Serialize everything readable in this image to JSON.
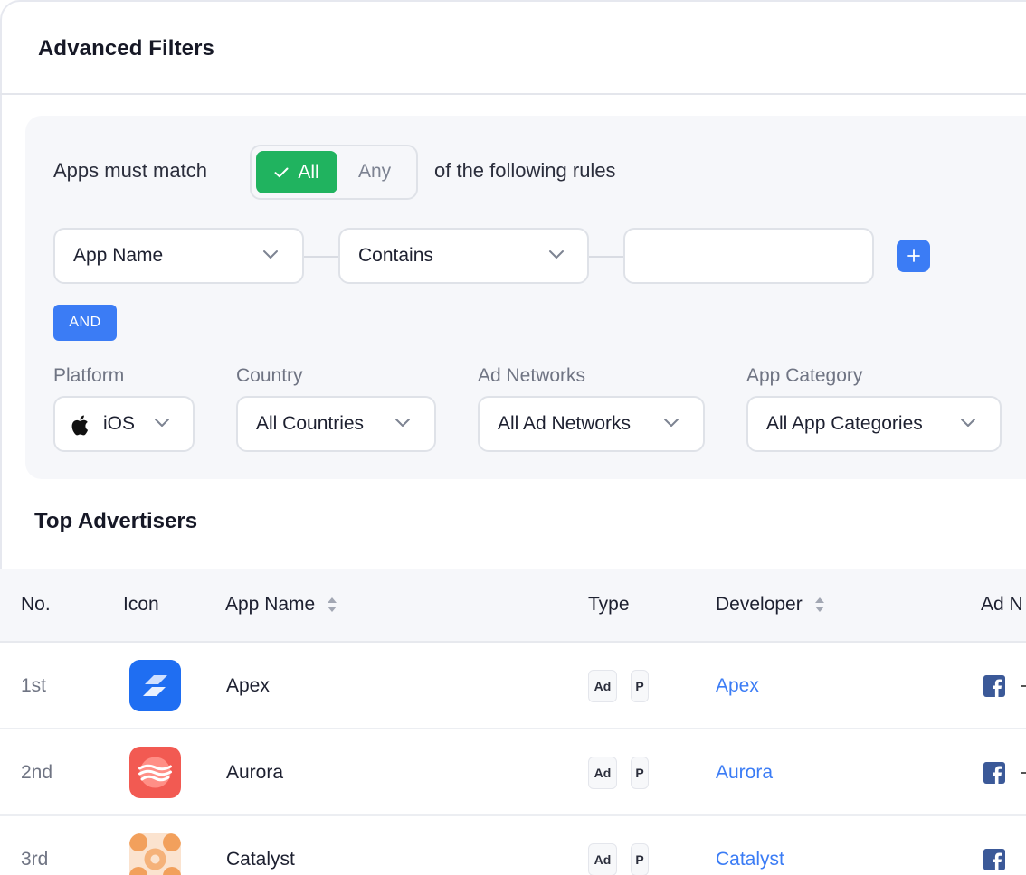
{
  "header": {
    "title": "Advanced Filters"
  },
  "match": {
    "prefix": "Apps must match",
    "options": [
      {
        "label": "All",
        "selected": true
      },
      {
        "label": "Any",
        "selected": false
      }
    ],
    "suffix": "of the following rules"
  },
  "rule": {
    "field": "App Name",
    "operator": "Contains",
    "value": "",
    "add_icon": "plus-icon",
    "conjunction": "AND"
  },
  "filters": {
    "platform": {
      "label": "Platform",
      "value": "iOS",
      "icon": "apple-icon"
    },
    "country": {
      "label": "Country",
      "value": "All Countries"
    },
    "ad_networks": {
      "label": "Ad Networks",
      "value": "All Ad Networks"
    },
    "app_category": {
      "label": "App Category",
      "value": "All App Categories"
    }
  },
  "table": {
    "title": "Top Advertisers",
    "columns": [
      "No.",
      "Icon",
      "App Name",
      "Type",
      "Developer",
      "Ad N"
    ],
    "rows": [
      {
        "rank": "1st",
        "app": "Apex",
        "types": [
          "Ad",
          "P"
        ],
        "developer": "Apex",
        "network_icon": "facebook-icon"
      },
      {
        "rank": "2nd",
        "app": "Aurora",
        "types": [
          "Ad",
          "P"
        ],
        "developer": "Aurora",
        "network_icon": "facebook-icon"
      },
      {
        "rank": "3rd",
        "app": "Catalyst",
        "types": [
          "Ad",
          "P"
        ],
        "developer": "Catalyst",
        "network_icon": "facebook-icon"
      }
    ]
  },
  "colors": {
    "accent_green": "#20b35f",
    "accent_blue": "#3b7cf5",
    "facebook_blue": "#3b5998"
  }
}
